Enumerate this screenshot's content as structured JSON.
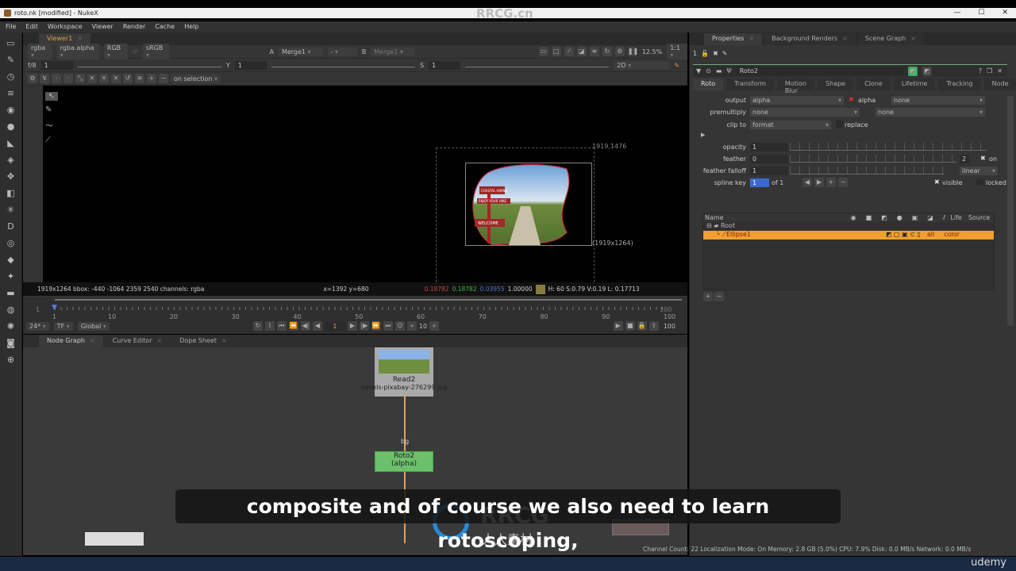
{
  "window": {
    "title": "roto.nk [modified] - NukeX",
    "controls": [
      "—",
      "☐",
      "✕"
    ]
  },
  "watermark_top": "RRCG.cn",
  "menu": [
    "File",
    "Edit",
    "Workspace",
    "Viewer",
    "Render",
    "Cache",
    "Help"
  ],
  "viewer": {
    "tab": "Viewer1",
    "row1": {
      "channels": "rgba",
      "alpha": "rgba.alpha",
      "display": "RGB",
      "ip": "IP",
      "lut": "sRGB",
      "a_label": "A",
      "a_input": "Merge1",
      "a_op": "-",
      "b_label": "B",
      "b_input": "Merge1",
      "zoom": "12.5%",
      "ratio": "1:1"
    },
    "row2": {
      "fstop": "f/8",
      "gain": "1",
      "y_label": "Y",
      "y": "1",
      "s_label": "S",
      "s": "1",
      "mode": "2D"
    },
    "row3": {
      "selection": "on selection"
    },
    "format_label": "1919,1476",
    "format_label2": "(1919x1264)",
    "info": {
      "left": "1919x1264  bbox: -440 -1064 2359 2540 channels: rgba",
      "coords": "x=1392 y=680",
      "r": "0.18782",
      "g": "0.18782",
      "b": "0.03955",
      "a": "1.00000",
      "hsv": "H: 60 S:0.79 V:0.19  L: 0.17713",
      "swatch": "#857a40"
    },
    "sign": {
      "line1": "COASTAL HIKING",
      "line2": "ENJOY YOUR HIKE",
      "line3": "WELCOME"
    }
  },
  "timeline": {
    "start": "1",
    "end": "100",
    "ticks": [
      "1",
      "10",
      "20",
      "30",
      "40",
      "50",
      "60",
      "70",
      "80",
      "90",
      "100"
    ],
    "fps": "24*",
    "tf": "TF",
    "scope": "Global",
    "frame": "1",
    "step": "10",
    "end_field": "100",
    "out_field": "100"
  },
  "nodegraph": {
    "tabs": [
      "Node Graph",
      "Curve Editor",
      "Dope Sheet"
    ],
    "read": {
      "name": "Read2",
      "file": "pexels-pixabay-276299.jpg"
    },
    "roto": {
      "name": "Roto2",
      "sub": "(alpha)"
    },
    "bg_label": "bg"
  },
  "properties": {
    "tabs": [
      "Properties",
      "Background Renders",
      "Scene Graph"
    ],
    "count": "1",
    "node_name": "Roto2",
    "subtabs": [
      "Roto",
      "Transform",
      "Motion Blur",
      "Shape",
      "Clone",
      "Lifetime",
      "Tracking",
      "Node"
    ],
    "output": {
      "label": "output",
      "value": "alpha",
      "check": "alpha",
      "other": "none"
    },
    "premultiply": {
      "label": "premultiply",
      "value": "none",
      "other": "none"
    },
    "clip_to": {
      "label": "clip to",
      "value": "format",
      "check": "replace"
    },
    "opacity": {
      "label": "opacity",
      "value": "1"
    },
    "feather": {
      "label": "feather",
      "value": "0",
      "extra": "2",
      "on": "on"
    },
    "feather_falloff": {
      "label": "feather falloff",
      "value": "1",
      "mode": "linear"
    },
    "spline_key": {
      "label": "spline key",
      "value": "1",
      "of": "of 1",
      "visible": "visible",
      "locked": "locked"
    },
    "columns": [
      "Name",
      "Life",
      "Source"
    ],
    "rows": [
      {
        "name": "Root"
      },
      {
        "name": "Ellipse1",
        "life": "all",
        "source": "color"
      }
    ],
    "accent": "#f0a030"
  },
  "subtitle": "composite and of course we also need to learn rotoscoping,",
  "status": "Channel Count: 22  Localization Mode: On  Memory: 2.8 GB (5.0%)  CPU: 7.9%  Disk: 0.0 MB/s  Network: 0.0 MB/s",
  "brand": "udemy",
  "logo": {
    "text": "RRCG",
    "sub": "人人素材"
  }
}
